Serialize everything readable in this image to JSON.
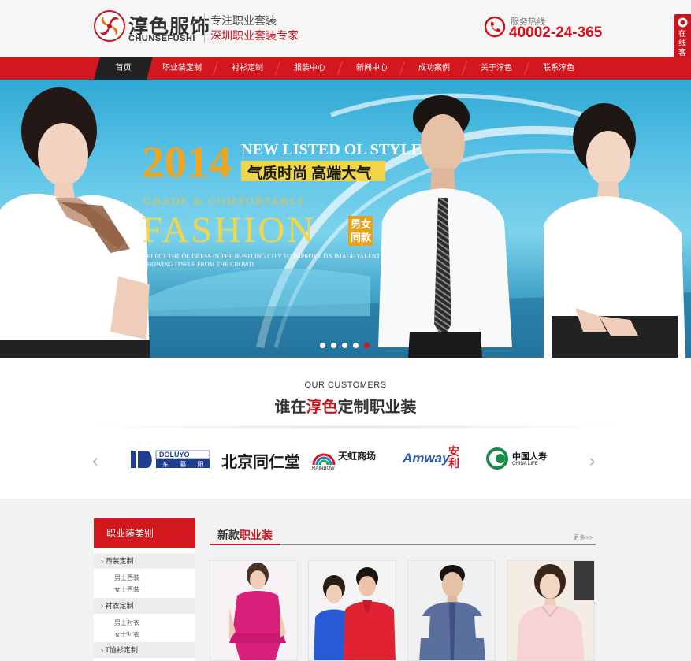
{
  "header": {
    "brand_cn": "淳色服饰",
    "brand_en": "CHUNSEFUSHI",
    "slogan_line1": "专注职业套装",
    "slogan_line2": "深圳职业套装专家",
    "hotline_label": "服务热线",
    "hotline_number": "40002-24-365"
  },
  "service_tab": {
    "label": "在线客服",
    "arrow": "<<"
  },
  "nav": {
    "items": [
      {
        "label": "首页",
        "active": true
      },
      {
        "label": "职业装定制"
      },
      {
        "label": "衬衫定制"
      },
      {
        "label": "服装中心"
      },
      {
        "label": "新闻中心"
      },
      {
        "label": "成功案例"
      },
      {
        "label": "关于淳色"
      },
      {
        "label": "联系淳色"
      }
    ]
  },
  "banner": {
    "year": "2014",
    "headline": "NEW LISTED OL STYLE",
    "tagline": "气质时尚 高端大气",
    "grade": "GRADE & COMFORTABLE",
    "fashion": "FASHION",
    "gender": "男女同款",
    "description": "SELECT THE OL DRESS IN THE BUSTLING CITY TO IMPROVE ITS IMAGE TALENT SHOWING ITSELF FROM THE CROWD.",
    "slide_count": 5,
    "active_slide": 5
  },
  "customers": {
    "title_en": "OUR CUSTOMERS",
    "title_prefix": "谁在",
    "title_highlight": "淳色",
    "title_suffix": "定制职业装",
    "prev_arrow": "‹",
    "next_arrow": "›",
    "logos": [
      {
        "name": "DOLUYO",
        "sub": "东 暮 阳"
      },
      {
        "name": "北京同仁堂"
      },
      {
        "name": "天虹商场",
        "sub": "RAINBOW"
      },
      {
        "name": "Amway",
        "sub": "安利"
      },
      {
        "name": "中国人寿",
        "sub": "CHINA LIFE"
      }
    ]
  },
  "categories": {
    "title": "职业装类别",
    "groups": [
      {
        "label": "西装定制",
        "items": [
          "男士西装",
          "女士西装"
        ]
      },
      {
        "label": "衬衣定制",
        "items": [
          "男士衬衣",
          "女士衬衣"
        ]
      },
      {
        "label": "T恤衫定制",
        "items": []
      }
    ]
  },
  "products": {
    "title_prefix": "新款",
    "title_highlight": "职业装",
    "more": "更多>>",
    "items": [
      {
        "name": "rose-dress"
      },
      {
        "name": "polo-couple"
      },
      {
        "name": "man-shirt"
      },
      {
        "name": "woman-pink-shirt"
      }
    ]
  },
  "colors": {
    "brand_red": "#d2171f",
    "accent_red": "#c9151e",
    "banner_yellow": "#f1d64a",
    "banner_orange": "#f1a51e"
  }
}
